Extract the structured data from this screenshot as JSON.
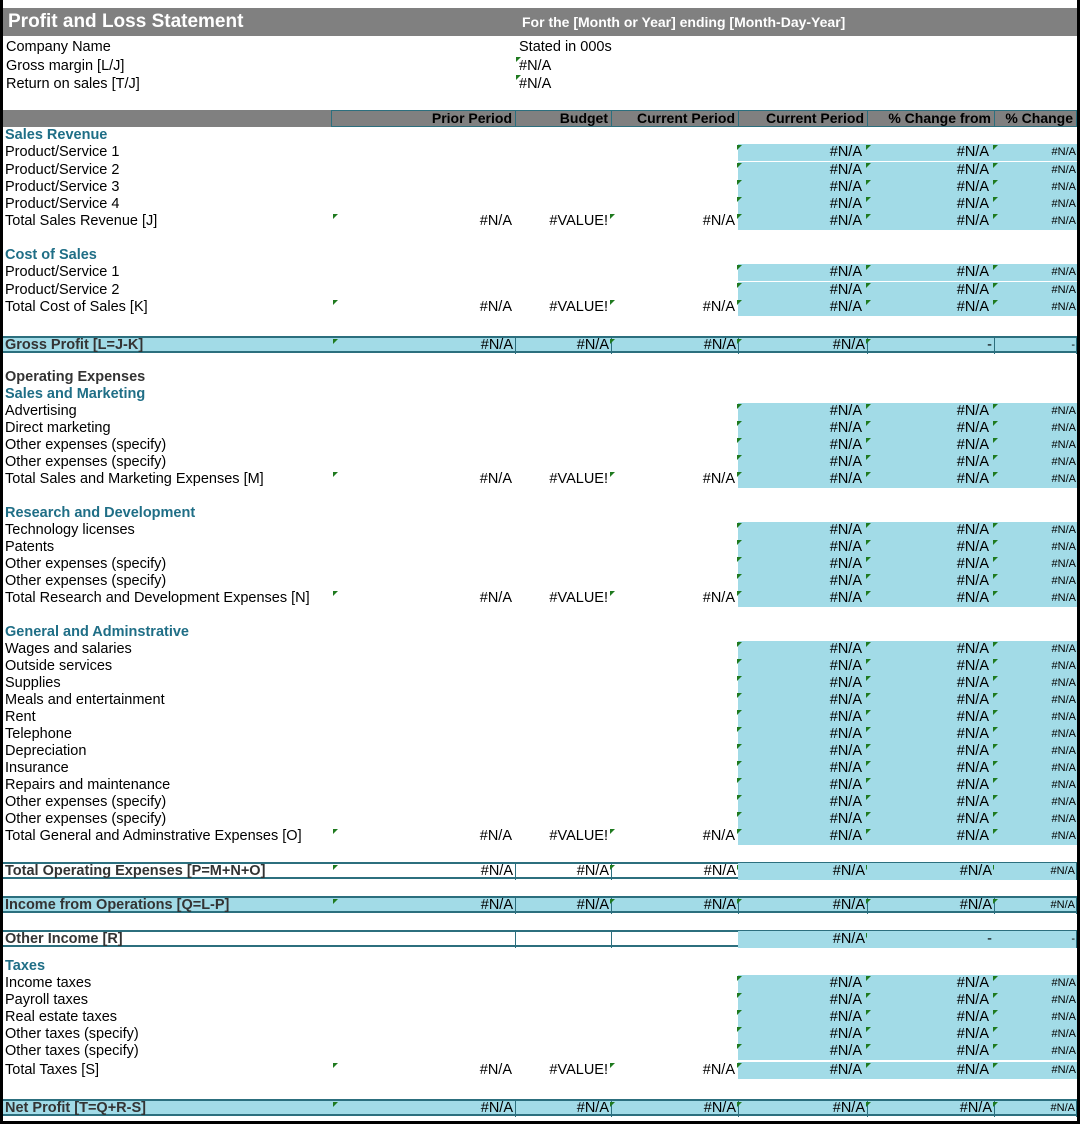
{
  "title": "Profit and Loss Statement",
  "period_text": "For the [Month or Year] ending [Month-Day-Year]",
  "company_name": "Company Name",
  "stated_in": "Stated in 000s",
  "gross_margin_label": "Gross margin  [L/J]",
  "gross_margin_value": "#N/A",
  "return_on_sales_label": "Return on sales  [T/J]",
  "return_on_sales_value": "#N/A",
  "columns": [
    "Prior Period",
    "Budget",
    "Current Period",
    "Current Period",
    "% Change from",
    "% Change"
  ],
  "colors": {
    "header_gray": "#808080",
    "accent_blue": "#a2dbe7",
    "section_teal": "#1f6e86",
    "border_teal": "#2c6f7e",
    "comment_green": "#1f7a1f"
  },
  "rows": [
    {
      "type": "section",
      "label": "Sales Revenue"
    },
    {
      "type": "item",
      "label": "Product/Service 1",
      "vals": [
        "",
        "",
        "",
        "#N/A",
        "#N/A",
        "#N/A"
      ]
    },
    {
      "type": "item",
      "label": "Product/Service 2",
      "vals": [
        "",
        "",
        "",
        "#N/A",
        "#N/A",
        "#N/A"
      ]
    },
    {
      "type": "item",
      "label": "Product/Service 3",
      "vals": [
        "",
        "",
        "",
        "#N/A",
        "#N/A",
        "#N/A"
      ]
    },
    {
      "type": "item",
      "label": "Product/Service 4",
      "vals": [
        "",
        "",
        "",
        "#N/A",
        "#N/A",
        "#N/A"
      ]
    },
    {
      "type": "total",
      "label": "Total Sales Revenue  [J]",
      "vals": [
        "#N/A",
        "#VALUE!",
        "#N/A",
        "#N/A",
        "#N/A",
        "#N/A"
      ]
    },
    {
      "type": "blank"
    },
    {
      "type": "section",
      "label": "Cost of Sales"
    },
    {
      "type": "item",
      "label": "Product/Service 1",
      "vals": [
        "",
        "",
        "",
        "#N/A",
        "#N/A",
        "#N/A"
      ]
    },
    {
      "type": "item",
      "label": "Product/Service 2",
      "vals": [
        "",
        "",
        "",
        "#N/A",
        "#N/A",
        "#N/A"
      ]
    },
    {
      "type": "total",
      "label": "Total Cost of Sales  [K]",
      "vals": [
        "#N/A",
        "#VALUE!",
        "#N/A",
        "#N/A",
        "#N/A",
        "#N/A"
      ]
    },
    {
      "type": "blank"
    },
    {
      "type": "summary",
      "label": "Gross Profit  [L=J-K]",
      "blue": true,
      "vals": [
        "#N/A",
        "#N/A",
        "#N/A",
        "#N/A",
        "-",
        "-"
      ]
    },
    {
      "type": "blank"
    },
    {
      "type": "opx",
      "label": "Operating Expenses"
    },
    {
      "type": "section",
      "label": "Sales and Marketing"
    },
    {
      "type": "item",
      "label": "Advertising",
      "vals": [
        "",
        "",
        "",
        "#N/A",
        "#N/A",
        "#N/A"
      ]
    },
    {
      "type": "item",
      "label": "Direct marketing",
      "vals": [
        "",
        "",
        "",
        "#N/A",
        "#N/A",
        "#N/A"
      ]
    },
    {
      "type": "item",
      "label": "Other expenses (specify)",
      "vals": [
        "",
        "",
        "",
        "#N/A",
        "#N/A",
        "#N/A"
      ]
    },
    {
      "type": "item",
      "label": "Other expenses (specify)",
      "vals": [
        "",
        "",
        "",
        "#N/A",
        "#N/A",
        "#N/A"
      ]
    },
    {
      "type": "total",
      "label": "Total Sales and Marketing Expenses  [M]",
      "vals": [
        "#N/A",
        "#VALUE!",
        "#N/A",
        "#N/A",
        "#N/A",
        "#N/A"
      ]
    },
    {
      "type": "blank"
    },
    {
      "type": "section",
      "label": "Research and Development"
    },
    {
      "type": "item",
      "label": "Technology licenses",
      "vals": [
        "",
        "",
        "",
        "#N/A",
        "#N/A",
        "#N/A"
      ]
    },
    {
      "type": "item",
      "label": "Patents",
      "vals": [
        "",
        "",
        "",
        "#N/A",
        "#N/A",
        "#N/A"
      ]
    },
    {
      "type": "item",
      "label": "Other expenses (specify)",
      "vals": [
        "",
        "",
        "",
        "#N/A",
        "#N/A",
        "#N/A"
      ]
    },
    {
      "type": "item",
      "label": "Other expenses (specify)",
      "vals": [
        "",
        "",
        "",
        "#N/A",
        "#N/A",
        "#N/A"
      ]
    },
    {
      "type": "total",
      "label": "Total Research and Development Expenses  [N]",
      "vals": [
        "#N/A",
        "#VALUE!",
        "#N/A",
        "#N/A",
        "#N/A",
        "#N/A"
      ]
    },
    {
      "type": "blank"
    },
    {
      "type": "section",
      "label": "General and Adminstrative"
    },
    {
      "type": "item",
      "label": "Wages and salaries",
      "vals": [
        "",
        "",
        "",
        "#N/A",
        "#N/A",
        "#N/A"
      ]
    },
    {
      "type": "item",
      "label": "Outside services",
      "vals": [
        "",
        "",
        "",
        "#N/A",
        "#N/A",
        "#N/A"
      ]
    },
    {
      "type": "item",
      "label": "Supplies",
      "vals": [
        "",
        "",
        "",
        "#N/A",
        "#N/A",
        "#N/A"
      ]
    },
    {
      "type": "item",
      "label": "Meals and entertainment",
      "vals": [
        "",
        "",
        "",
        "#N/A",
        "#N/A",
        "#N/A"
      ]
    },
    {
      "type": "item",
      "label": "Rent",
      "vals": [
        "",
        "",
        "",
        "#N/A",
        "#N/A",
        "#N/A"
      ]
    },
    {
      "type": "item",
      "label": "Telephone",
      "vals": [
        "",
        "",
        "",
        "#N/A",
        "#N/A",
        "#N/A"
      ]
    },
    {
      "type": "item",
      "label": "Depreciation",
      "vals": [
        "",
        "",
        "",
        "#N/A",
        "#N/A",
        "#N/A"
      ]
    },
    {
      "type": "item",
      "label": "Insurance",
      "vals": [
        "",
        "",
        "",
        "#N/A",
        "#N/A",
        "#N/A"
      ]
    },
    {
      "type": "item",
      "label": "Repairs and maintenance",
      "vals": [
        "",
        "",
        "",
        "#N/A",
        "#N/A",
        "#N/A"
      ]
    },
    {
      "type": "item",
      "label": "Other expenses (specify)",
      "vals": [
        "",
        "",
        "",
        "#N/A",
        "#N/A",
        "#N/A"
      ]
    },
    {
      "type": "item",
      "label": "Other expenses (specify)",
      "vals": [
        "",
        "",
        "",
        "#N/A",
        "#N/A",
        "#N/A"
      ]
    },
    {
      "type": "total",
      "label": "Total General and Adminstrative Expenses  [O]",
      "vals": [
        "#N/A",
        "#VALUE!",
        "#N/A",
        "#N/A",
        "#N/A",
        "#N/A"
      ]
    },
    {
      "type": "blank"
    },
    {
      "type": "summary",
      "label": "Total Operating Expenses  [P=M+N+O]",
      "blue": false,
      "vals": [
        "#N/A",
        "#N/A",
        "#N/A",
        "#N/A",
        "#N/A",
        "#N/A"
      ]
    },
    {
      "type": "blank"
    },
    {
      "type": "summary",
      "label": "Income from Operations  [Q=L-P]",
      "blue": true,
      "vals": [
        "#N/A",
        "#N/A",
        "#N/A",
        "#N/A",
        "#N/A",
        "#N/A"
      ]
    },
    {
      "type": "blank"
    },
    {
      "type": "summary",
      "label": "Other Income  [R]",
      "blue": false,
      "vals": [
        "",
        "",
        "",
        "#N/A",
        "-",
        "-"
      ]
    },
    {
      "type": "blank"
    },
    {
      "type": "section",
      "label": "Taxes"
    },
    {
      "type": "item",
      "label": "Income taxes",
      "vals": [
        "",
        "",
        "",
        "#N/A",
        "#N/A",
        "#N/A"
      ]
    },
    {
      "type": "item",
      "label": "Payroll taxes",
      "vals": [
        "",
        "",
        "",
        "#N/A",
        "#N/A",
        "#N/A"
      ]
    },
    {
      "type": "item",
      "label": "Real estate taxes",
      "vals": [
        "",
        "",
        "",
        "#N/A",
        "#N/A",
        "#N/A"
      ]
    },
    {
      "type": "item",
      "label": "Other taxes (specify)",
      "vals": [
        "",
        "",
        "",
        "#N/A",
        "#N/A",
        "#N/A"
      ]
    },
    {
      "type": "item",
      "label": "Other taxes (specify)",
      "vals": [
        "",
        "",
        "",
        "#N/A",
        "#N/A",
        "#N/A"
      ]
    },
    {
      "type": "total",
      "label": "Total Taxes  [S]",
      "vals": [
        "#N/A",
        "#VALUE!",
        "#N/A",
        "#N/A",
        "#N/A",
        "#N/A"
      ]
    },
    {
      "type": "blank"
    },
    {
      "type": "summary",
      "label": "Net Profit  [T=Q+R-S]",
      "blue": true,
      "vals": [
        "#N/A",
        "#N/A",
        "#N/A",
        "#N/A",
        "#N/A",
        "#N/A"
      ]
    }
  ]
}
